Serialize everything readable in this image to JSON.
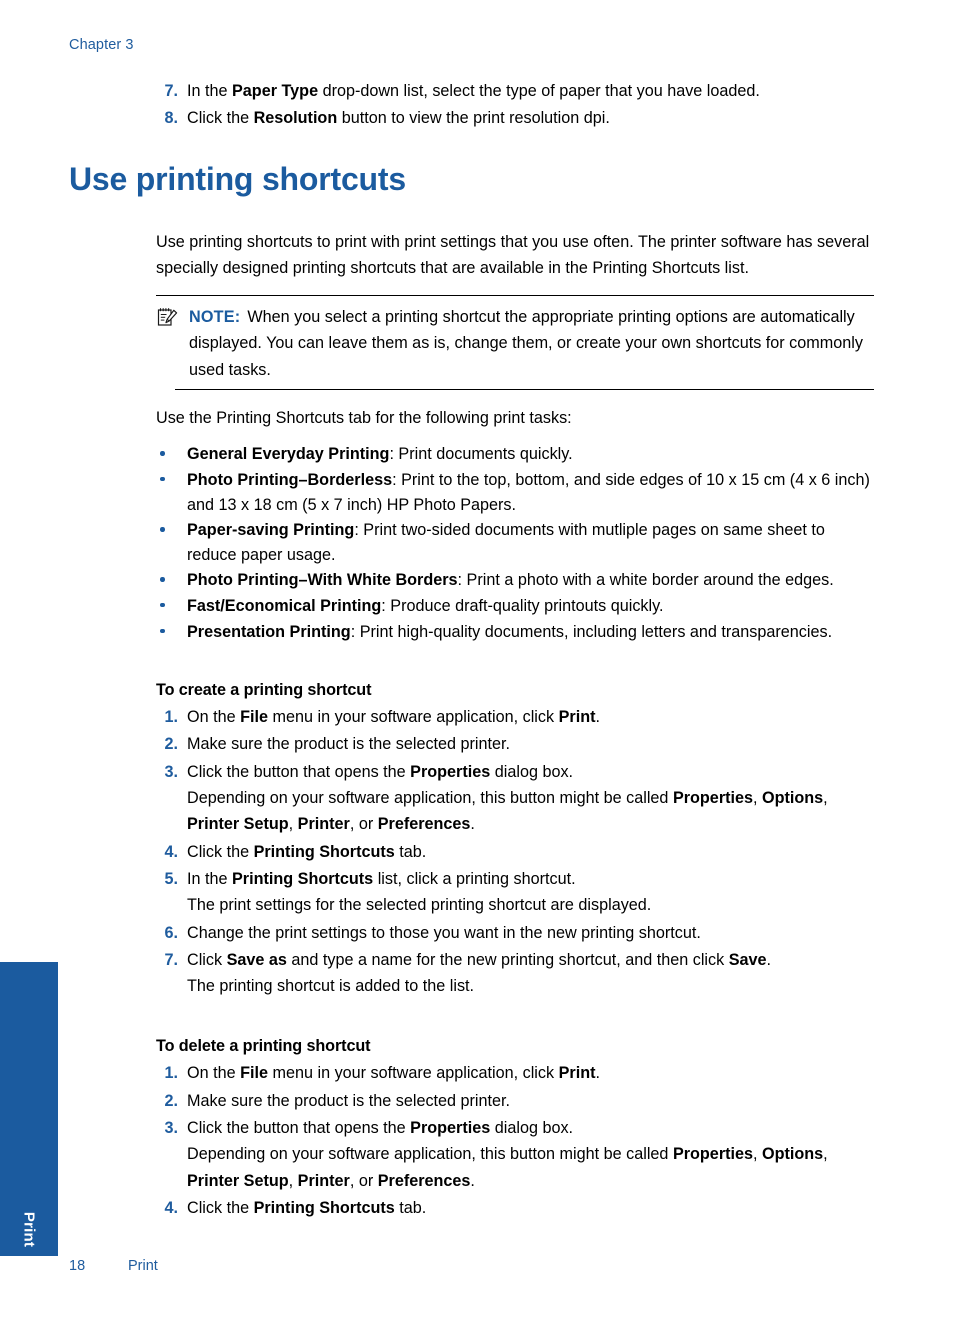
{
  "header": {
    "chapter": "Chapter 3"
  },
  "top_steps": [
    {
      "num": "7.",
      "html": "In the <b>Paper Type</b> drop-down list, select the type of paper that you have loaded."
    },
    {
      "num": "8.",
      "html": "Click the <b>Resolution</b> button to view the print resolution dpi."
    }
  ],
  "section": {
    "title": "Use printing shortcuts",
    "intro": "Use printing shortcuts to print with print settings that you use often. The printer software has several specially designed printing shortcuts that are available in the Printing Shortcuts list.",
    "note": {
      "icon": "note-pencil-icon",
      "label": "NOTE:",
      "text": "When you select a printing shortcut the appropriate printing options are automatically displayed. You can leave them as is, change them, or create your own shortcuts for commonly used tasks."
    },
    "tasks_intro": "Use the Printing Shortcuts tab for the following print tasks:",
    "bullets": [
      {
        "term": "General Everyday Printing",
        "desc": ": Print documents quickly."
      },
      {
        "term": "Photo Printing–Borderless",
        "desc": ": Print to the top, bottom, and side edges of 10 x 15 cm (4 x 6 inch) and 13 x 18 cm (5 x 7 inch) HP Photo Papers."
      },
      {
        "term": "Paper-saving Printing",
        "desc": ": Print two-sided documents with mutliple pages on same sheet to reduce paper usage."
      },
      {
        "term": "Photo Printing–With White Borders",
        "desc": ": Print a photo with a white border around the edges."
      },
      {
        "term": "Fast/Economical Printing",
        "desc": ": Produce draft-quality printouts quickly."
      },
      {
        "term": "Presentation Printing",
        "desc": ": Print high-quality documents, including letters and transparencies."
      }
    ]
  },
  "create_procedure": {
    "title": "To create a printing shortcut",
    "steps": [
      {
        "num": "1.",
        "html": "On the <b>File</b> menu in your software application, click <b>Print</b>."
      },
      {
        "num": "2.",
        "html": "Make sure the product is the selected printer."
      },
      {
        "num": "3.",
        "html": "Click the button that opens the <b>Properties</b> dialog box.<span class=\"sub\">Depending on your software application, this button might be called <b>Properties</b>, <b>Options</b>, <b>Printer Setup</b>, <b>Printer</b>, or <b>Preferences</b>.</span>"
      },
      {
        "num": "4.",
        "html": "Click the <b>Printing Shortcuts</b> tab."
      },
      {
        "num": "5.",
        "html": "In the <b>Printing Shortcuts</b> list, click a printing shortcut.<span class=\"sub\">The print settings for the selected printing shortcut are displayed.</span>"
      },
      {
        "num": "6.",
        "html": "Change the print settings to those you want in the new printing shortcut."
      },
      {
        "num": "7.",
        "html": "Click <b>Save as</b> and type a name for the new printing shortcut, and then click <b>Save</b>.<span class=\"sub\">The printing shortcut is added to the list.</span>"
      }
    ]
  },
  "delete_procedure": {
    "title": "To delete a printing shortcut",
    "steps": [
      {
        "num": "1.",
        "html": "On the <b>File</b> menu in your software application, click <b>Print</b>."
      },
      {
        "num": "2.",
        "html": "Make sure the product is the selected printer."
      },
      {
        "num": "3.",
        "html": "Click the button that opens the <b>Properties</b> dialog box.<span class=\"sub\">Depending on your software application, this button might be called <b>Properties</b>, <b>Options</b>, <b>Printer Setup</b>, <b>Printer</b>, or <b>Preferences</b>.</span>"
      },
      {
        "num": "4.",
        "html": "Click the <b>Printing Shortcuts</b> tab."
      }
    ]
  },
  "side_tab": {
    "label": "Print"
  },
  "footer": {
    "page_number": "18",
    "section_name": "Print"
  },
  "colors": {
    "accent_blue": "#1b5b9f",
    "header_blue": "#1f5c9e",
    "text_black": "#000000",
    "page_background": "#ffffff"
  }
}
